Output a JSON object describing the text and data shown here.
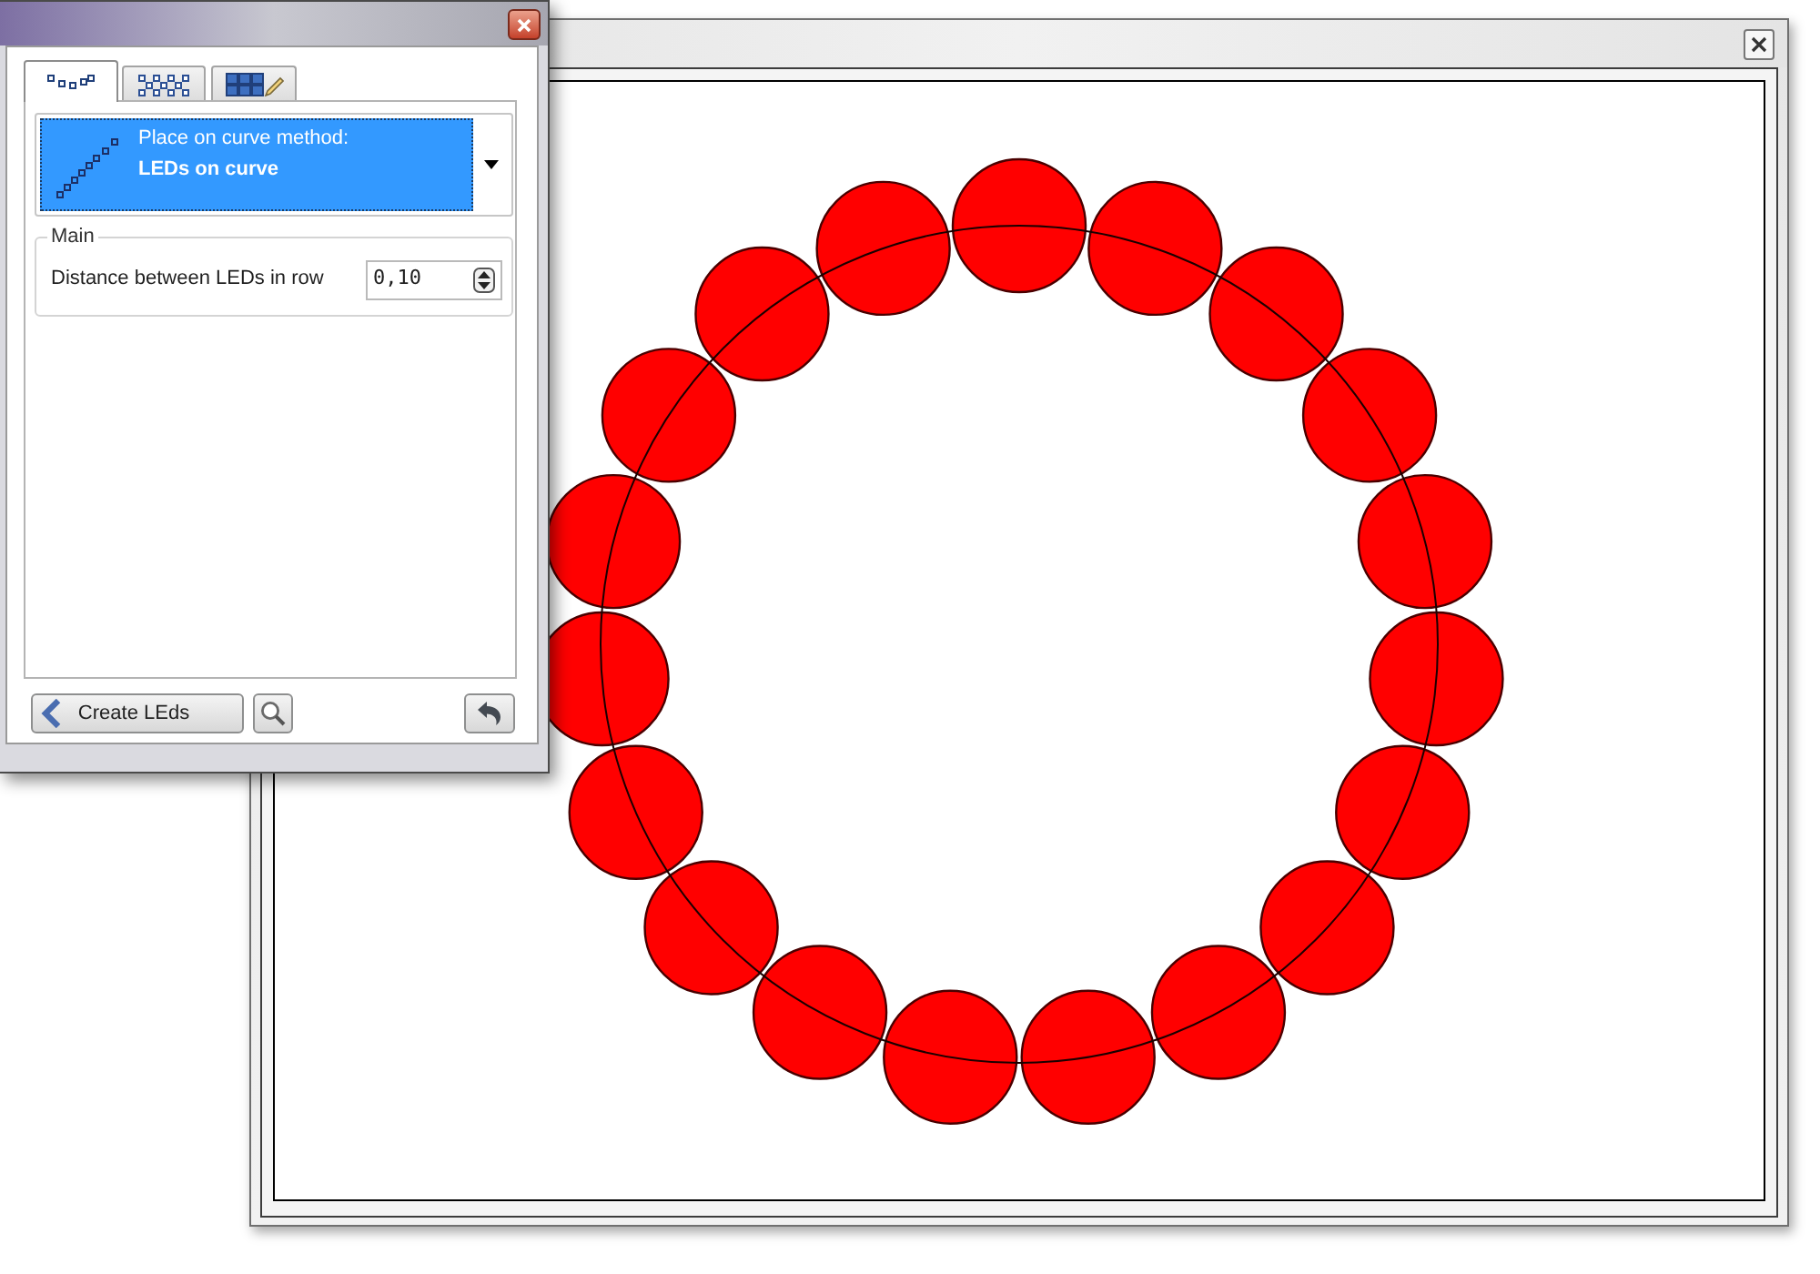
{
  "tool_window": {
    "tabs": [
      {
        "selected": true
      },
      {
        "selected": false
      },
      {
        "selected": false
      }
    ],
    "method_dropdown": {
      "caption": "Place on curve method:",
      "value": "LEDs on curve"
    },
    "group": {
      "title": "Main",
      "fields": [
        {
          "label": "Distance between LEDs in row",
          "value": "0,10"
        }
      ]
    },
    "create_button": "Create LEds"
  }
}
